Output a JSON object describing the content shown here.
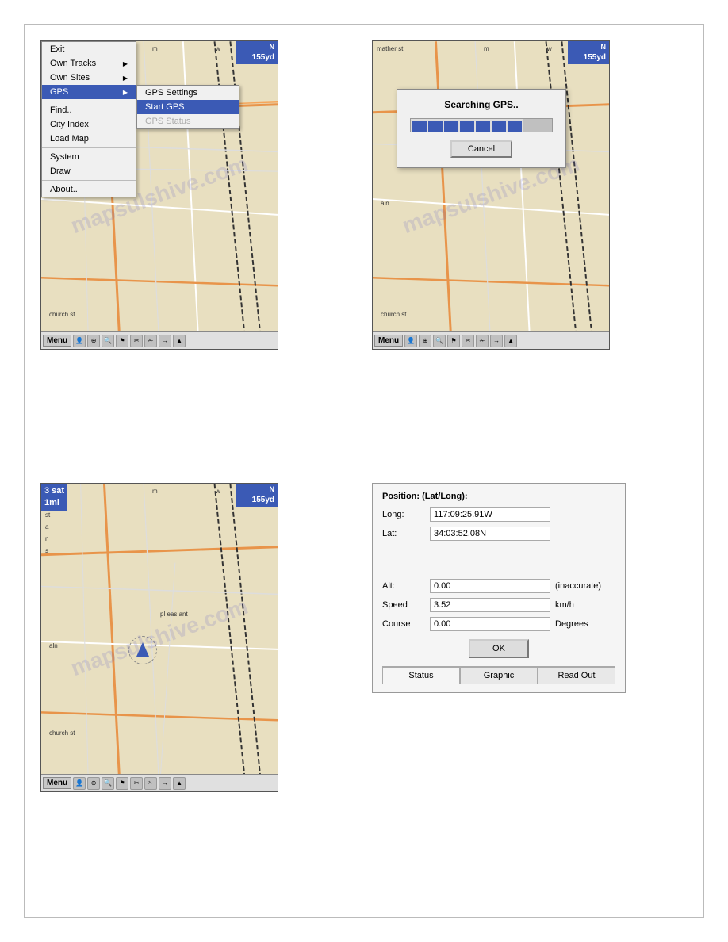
{
  "map1": {
    "compass": "N",
    "distance": "155yd",
    "menu_label": "Menu",
    "dropdown": {
      "items": [
        {
          "label": "Exit",
          "id": "exit"
        },
        {
          "label": "Own Tracks",
          "id": "own-tracks",
          "has_arrow": true
        },
        {
          "label": "Own Sites",
          "id": "own-sites",
          "has_arrow": true
        },
        {
          "label": "GPS",
          "id": "gps",
          "has_arrow": true,
          "selected": true
        },
        {
          "label": "Find..",
          "id": "find"
        },
        {
          "label": "City Index",
          "id": "city-index"
        },
        {
          "label": "Load Map",
          "id": "load-map"
        },
        {
          "label": "System",
          "id": "system"
        },
        {
          "label": "Draw",
          "id": "draw"
        },
        {
          "label": "About..",
          "id": "about"
        }
      ],
      "submenu": {
        "items": [
          {
            "label": "GPS Settings",
            "id": "gps-settings"
          },
          {
            "label": "Start GPS",
            "id": "start-gps",
            "selected": true
          },
          {
            "label": "GPS Status",
            "id": "gps-status",
            "disabled": true
          }
        ]
      }
    }
  },
  "map2": {
    "compass": "N",
    "distance": "155yd",
    "menu_label": "Menu",
    "dialog": {
      "title": "Searching GPS..",
      "progress_filled": 7,
      "progress_total": 9,
      "cancel_label": "Cancel"
    }
  },
  "map3": {
    "compass": "N",
    "distance": "155yd",
    "sat_count": "3 sat",
    "scale": "1mi",
    "menu_label": "Menu"
  },
  "gps_status": {
    "title": "Position: (Lat/Long):",
    "long_label": "Long:",
    "long_value": "117:09:25.91W",
    "lat_label": "Lat:",
    "lat_value": "34:03:52.08N",
    "alt_label": "Alt:",
    "alt_value": "0.00",
    "alt_note": "(inaccurate)",
    "speed_label": "Speed",
    "speed_value": "3.52",
    "speed_unit": "km/h",
    "course_label": "Course",
    "course_value": "0.00",
    "course_unit": "Degrees",
    "ok_label": "OK",
    "tabs": [
      {
        "label": "Status",
        "active": true
      },
      {
        "label": "Graphic",
        "active": false
      },
      {
        "label": "Read Out",
        "active": false
      }
    ]
  },
  "watermark": "mapsulshive.com"
}
